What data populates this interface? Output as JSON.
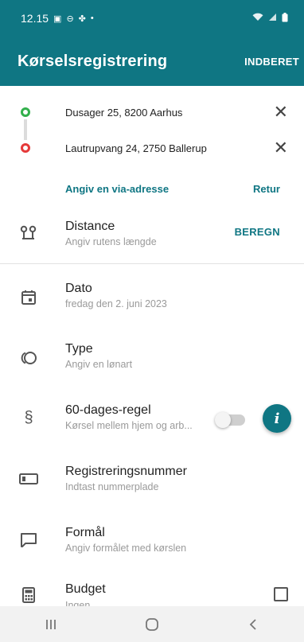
{
  "status": {
    "time": "12.15"
  },
  "appbar": {
    "title": "Kørselsregistrering",
    "action": "INDBERET"
  },
  "route": {
    "from": "Dusager 25, 8200 Aarhus",
    "to": "Lautrupvang 24, 2750 Ballerup",
    "via_link": "Angiv en via-adresse",
    "return_link": "Retur"
  },
  "distance": {
    "label": "Distance",
    "sub": "Angiv rutens længde",
    "action": "BEREGN"
  },
  "dato": {
    "label": "Dato",
    "sub": "fredag den 2. juni 2023"
  },
  "type": {
    "label": "Type",
    "sub": "Angiv en lønart"
  },
  "rule60": {
    "label": "60-dages-regel",
    "sub": "Kørsel mellem hjem og arb..."
  },
  "regnr": {
    "label": "Registreringsnummer",
    "sub": "Indtast nummerplade"
  },
  "formaal": {
    "label": "Formål",
    "sub": "Angiv formålet med kørslen"
  },
  "budget": {
    "label": "Budget",
    "sub": "Ingen"
  },
  "fab": {
    "label": "i"
  },
  "colors": {
    "primary": "#0f7683",
    "start_pin": "#33b04c",
    "end_pin": "#e53a3a"
  }
}
